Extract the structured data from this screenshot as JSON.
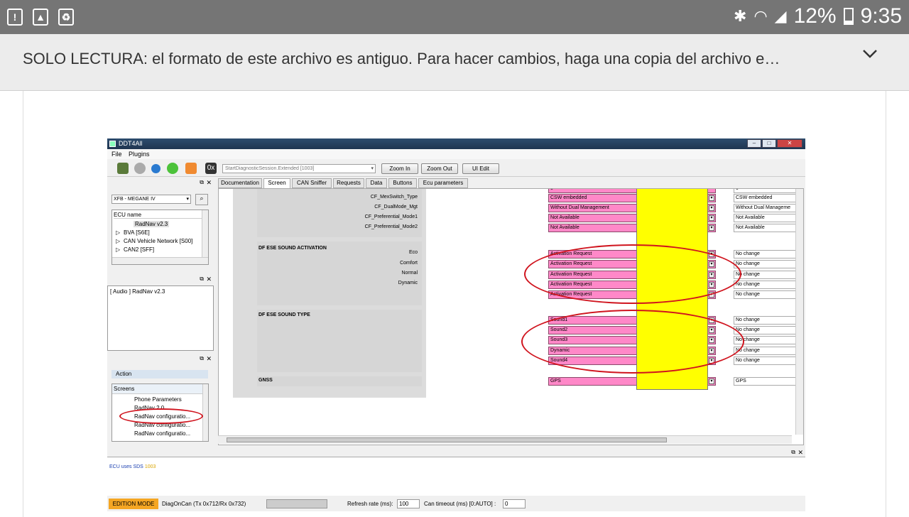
{
  "status_bar": {
    "battery": "12%",
    "time": "9:35"
  },
  "notice": {
    "text": "SOLO LECTURA: el formato de este archivo es antiguo. Para hacer cambios, haga una copia del archivo e…"
  },
  "app": {
    "title": "DDT4All",
    "menu": [
      "File",
      "Plugins"
    ],
    "toolbar": {
      "hex_label": "0x",
      "request_combo": "StartDiagnosticSession.Extended [1003]",
      "zoom_in": "Zoom In",
      "zoom_out": "Zoom Out",
      "ui_edit": "UI Edit"
    },
    "ecu_select": "XFB - MEGANE IV",
    "ecu_tree": {
      "header": "ECU name",
      "items": [
        "RadNav v2.3",
        "BVA [S6E]",
        "CAN Vehicle Network [S00]",
        "CAN2 [SFF]"
      ]
    },
    "audio_item": "[ Audio ] RadNav v2.3",
    "action_label": "Action",
    "screens": {
      "header": "Screens",
      "items": [
        "Phone Parameters",
        "RadNav 2.0",
        "RadNav configuratio...",
        "RadNav configuratio...",
        "RadNav configuratio..."
      ]
    },
    "tabs": [
      "Documentation",
      "Screen",
      "CAN Sniffer",
      "Requests",
      "Data",
      "Buttons",
      "Ecu parameters"
    ],
    "active_tab": "Screen",
    "screen": {
      "top_rows": [
        {
          "label": "",
          "value": "0",
          "current": "0"
        },
        {
          "label": "CF_MexSwitch_Type",
          "value": "CSW embedded",
          "current": "CSW embedded"
        },
        {
          "label": "CF_DualMode_Mgt",
          "value": "Without Dual Management",
          "current": "Without Dual Manageme"
        },
        {
          "label": "CF_Preferential_Mode1",
          "value": "Not Available",
          "current": "Not Available"
        },
        {
          "label": "CF_Preferential_Mode2",
          "value": "Not Available",
          "current": "Not Available"
        }
      ],
      "sound_activation": {
        "title": "DF ESE SOUND ACTIVATION",
        "rows": [
          {
            "label": "Eco",
            "value": "Activation Request",
            "current": "No change"
          },
          {
            "label": "Comfort",
            "value": "Activation Request",
            "current": "No change"
          },
          {
            "label": "Normal",
            "value": "Activation Request",
            "current": "No change"
          },
          {
            "label": "Dynamic",
            "value": "Activation Request",
            "current": "No change"
          },
          {
            "label": "",
            "value": "Activation Request",
            "current": "No change"
          }
        ]
      },
      "sound_type": {
        "title": "DF ESE SOUND TYPE",
        "rows": [
          {
            "value": "Sound1",
            "current": "No change"
          },
          {
            "value": "Sound2",
            "current": "No change"
          },
          {
            "value": "Sound3",
            "current": "No change"
          },
          {
            "value": "Dynamic",
            "current": "No change"
          },
          {
            "value": "Sound4",
            "current": "No change"
          }
        ]
      },
      "gnss": {
        "title": "GNSS",
        "value": "GPS",
        "current": "GPS"
      }
    },
    "message": {
      "text": "ECU uses SDS",
      "code": "1003"
    },
    "statusbar": {
      "mode": "EDITION MODE",
      "protocol": "DiagOnCan (Tx 0x712/Rx 0x732)",
      "refresh_label": "Refresh rate (ms):",
      "refresh_value": "100",
      "timeout_label": "Can timeout (ms) [0:AUTO] :",
      "timeout_value": "0"
    }
  },
  "colors": {
    "pink_field": "#ff88c8",
    "yellow_panel": "#ffff00",
    "edition_mode": "#f5a623",
    "annotation_red": "#d0141e"
  }
}
